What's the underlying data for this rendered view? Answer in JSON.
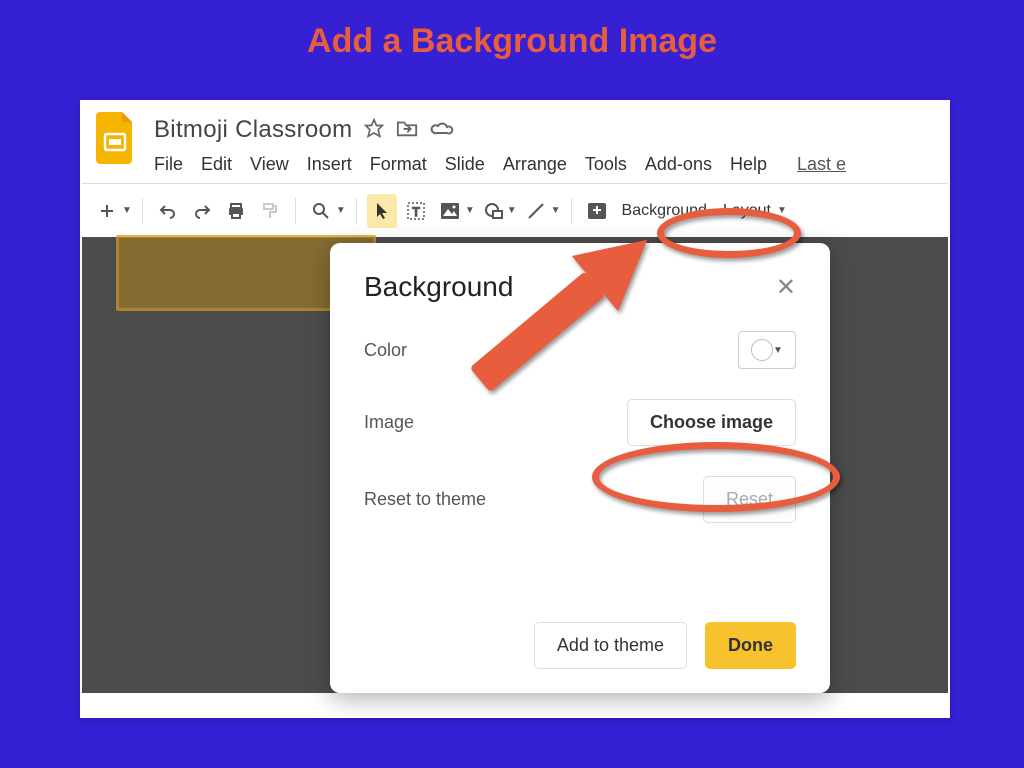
{
  "slide": {
    "title": "Add a Background Image"
  },
  "doc": {
    "title": "Bitmoji Classroom"
  },
  "menu": {
    "file": "File",
    "edit": "Edit",
    "view": "View",
    "insert": "Insert",
    "format": "Format",
    "slide": "Slide",
    "arrange": "Arrange",
    "tools": "Tools",
    "addons": "Add-ons",
    "help": "Help",
    "last_edit": "Last e"
  },
  "toolbar": {
    "background": "Background",
    "layout": "Layout"
  },
  "dialog": {
    "title": "Background",
    "color_label": "Color",
    "image_label": "Image",
    "choose_image": "Choose image",
    "reset_label": "Reset to theme",
    "reset_btn": "Reset",
    "add_to_theme": "Add to theme",
    "done": "Done"
  }
}
